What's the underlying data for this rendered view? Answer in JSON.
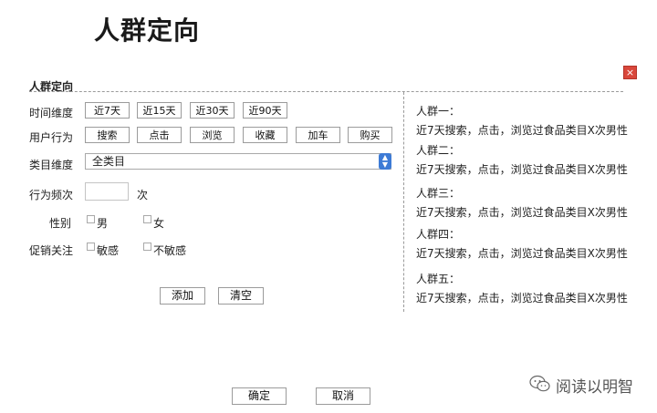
{
  "page_title": "人群定向",
  "dialog": {
    "title": "人群定向",
    "close_symbol": "×",
    "rows": {
      "time_label": "时间维度",
      "time_options": [
        "近7天",
        "近15天",
        "近30天",
        "近90天"
      ],
      "behavior_label": "用户行为",
      "behavior_options": [
        "搜索",
        "点击",
        "浏览",
        "收藏",
        "加车",
        "购买"
      ],
      "category_label": "类目维度",
      "category_value": "全类目",
      "frequency_label": "行为频次",
      "frequency_value": "",
      "frequency_unit": "次",
      "gender_label": "性别",
      "gender_options": [
        "男",
        "女"
      ],
      "promo_label": "促销关注",
      "promo_options": [
        "敏感",
        "不敏感"
      ]
    },
    "buttons": {
      "add": "添加",
      "clear": "清空"
    },
    "groups": [
      {
        "title": "人群一：",
        "desc": "近7天搜索，点击，浏览过食品类目X次男性"
      },
      {
        "title": "人群二：",
        "desc": "近7天搜索，点击，浏览过食品类目X次男性"
      },
      {
        "title": "人群三：",
        "desc": "近7天搜索，点击，浏览过食品类目X次男性"
      },
      {
        "title": "人群四：",
        "desc": "近7天搜索，点击，浏览过食品类目X次男性"
      },
      {
        "title": "人群五：",
        "desc": "近7天搜索，点击，浏览过食品类目X次男性"
      }
    ],
    "footer": {
      "ok": "确定",
      "cancel": "取消"
    }
  },
  "watermark": {
    "text": "阅读以明智",
    "icon": "wechat-icon"
  }
}
